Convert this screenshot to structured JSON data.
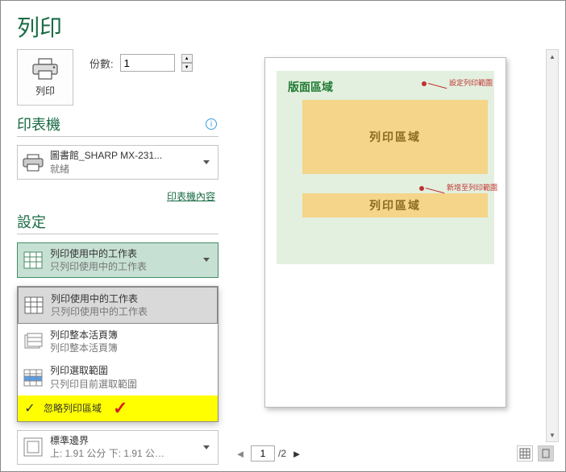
{
  "title": "列印",
  "print_button_label": "列印",
  "copies": {
    "label": "份數:",
    "value": "1"
  },
  "printer": {
    "section": "印表機",
    "name": "圖書館_SHARP MX-231...",
    "status": "就緒",
    "properties_link": "印表機內容"
  },
  "settings": {
    "section": "設定",
    "selected": {
      "title": "列印使用中的工作表",
      "subtitle": "只列印使用中的工作表"
    },
    "options": [
      {
        "title": "列印使用中的工作表",
        "subtitle": "只列印使用中的工作表"
      },
      {
        "title": "列印整本活頁簿",
        "subtitle": "列印整本活頁簿"
      },
      {
        "title": "列印選取範圍",
        "subtitle": "只列印目前選取範圍"
      }
    ],
    "ignore_print_area": "忽略列印區域",
    "margins": {
      "title": "標準邊界",
      "subtitle": "上: 1.91 公分 下: 1.91 公…"
    }
  },
  "preview": {
    "page_header": "版面區域",
    "callout1": "設定列印範圍",
    "callout2": "新增至列印範圍",
    "zone_label": "列印區域"
  },
  "nav": {
    "current": "1",
    "total": "/2"
  }
}
